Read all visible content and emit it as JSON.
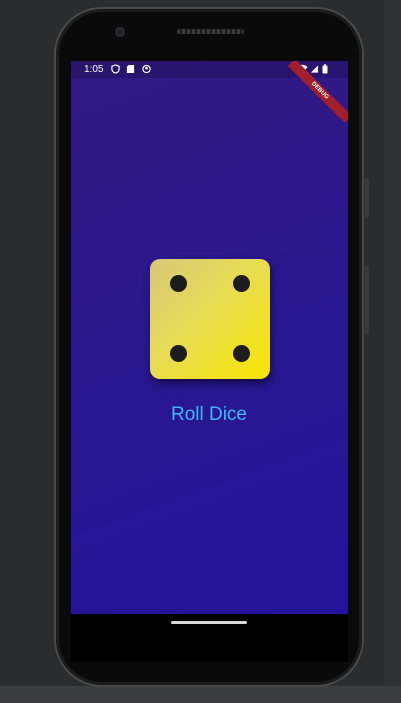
{
  "status_bar": {
    "time": "1:05",
    "left_icons": [
      "shield-icon",
      "sd-card-icon",
      "face-icon"
    ],
    "right_icons": [
      "wifi-icon",
      "signal-icon",
      "battery-icon"
    ]
  },
  "debug_banner": {
    "label": "DEBUG",
    "color": "#a31e2d"
  },
  "dice": {
    "face_value": 4,
    "colors": {
      "start": "#d8c87a",
      "end": "#f7e400",
      "pip": "#1d1d1d"
    }
  },
  "roll_button": {
    "label": "Roll Dice",
    "color": "#40b6f5"
  },
  "screen": {
    "background_start": "#321a80",
    "background_end": "#24149a"
  }
}
